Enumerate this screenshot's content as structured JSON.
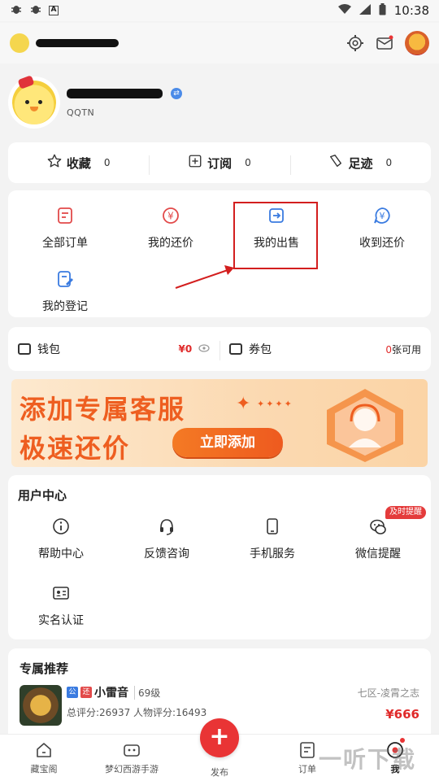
{
  "status_bar": {
    "time": "10:38",
    "left_icons": [
      "bug-icon",
      "bug-icon",
      "a-icon"
    ],
    "right_icons": [
      "wifi-icon",
      "signal-icon",
      "battery-icon"
    ]
  },
  "profile": {
    "user_id": "QQTN"
  },
  "stats": [
    {
      "label": "收藏",
      "count": "0",
      "icon": "star-icon"
    },
    {
      "label": "订阅",
      "count": "0",
      "icon": "subscribe-icon"
    },
    {
      "label": "足迹",
      "count": "0",
      "icon": "footprint-icon"
    }
  ],
  "orders": [
    {
      "label": "全部订单",
      "icon": "order-list-icon"
    },
    {
      "label": "我的还价",
      "icon": "yen-icon"
    },
    {
      "label": "我的出售",
      "icon": "sell-icon"
    },
    {
      "label": "收到还价",
      "icon": "yen-chat-icon"
    },
    {
      "label": "我的登记",
      "icon": "register-icon"
    }
  ],
  "wallet": {
    "label": "钱包",
    "amount": "¥0"
  },
  "coupon": {
    "label": "券包",
    "count": "0",
    "suffix": "张可用"
  },
  "banner": {
    "line1": "添加专属客服",
    "line2": "极速还价",
    "button": "立即添加"
  },
  "user_center": {
    "title": "用户中心",
    "items": [
      {
        "label": "帮助中心",
        "icon": "info-icon"
      },
      {
        "label": "反馈咨询",
        "icon": "headset-icon"
      },
      {
        "label": "手机服务",
        "icon": "phone-icon"
      },
      {
        "label": "微信提醒",
        "icon": "wechat-icon"
      },
      {
        "label": "实名认证",
        "icon": "id-card-icon"
      }
    ],
    "tag": "及时提醒"
  },
  "recommend": {
    "title": "专属推荐",
    "item": {
      "tag1": "公",
      "tag2": "还",
      "name": "小雷音",
      "level": "69级",
      "score": "总评分:26937 人物评分:16493",
      "server": "七区-凌霄之志",
      "price": "¥666"
    }
  },
  "nav": [
    {
      "label": "藏宝阁",
      "icon": "home-icon"
    },
    {
      "label": "梦幻西游手游",
      "icon": "gamepad-icon"
    },
    {
      "label": "发布",
      "icon": "plus-icon"
    },
    {
      "label": "订单",
      "icon": "order-icon"
    },
    {
      "label": "我",
      "icon": "me-icon"
    }
  ],
  "watermark": "一听下载",
  "colors": {
    "accent": "#e93435",
    "orange": "#ee5e20",
    "blue_icon": "#3a7be0",
    "red_icon": "#e24a4a"
  }
}
